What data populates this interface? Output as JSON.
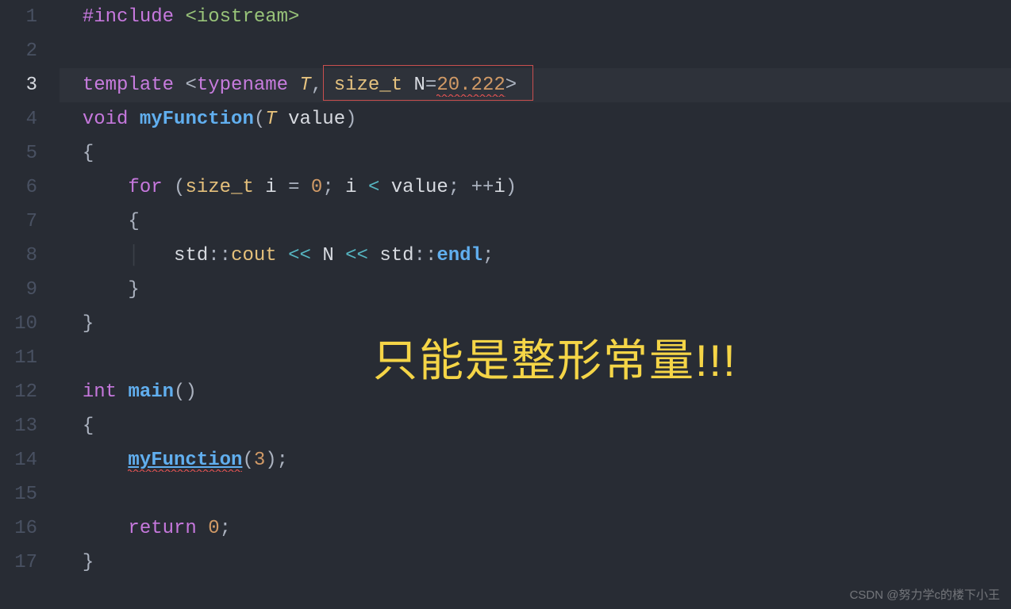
{
  "lines": {
    "count": 17,
    "active": 3
  },
  "code": {
    "l1_include": "#include",
    "l1_header": "<iostream>",
    "l3_template": "template",
    "l3_open": "<",
    "l3_typename": "typename",
    "l3_T": "T",
    "l3_comma": ",",
    "l3_size_t": "size_t",
    "l3_N": "N",
    "l3_eq": "=",
    "l3_val": "20.222",
    "l3_close": ">",
    "l4_void": "void",
    "l4_fn": "myFunction",
    "l4_lp": "(",
    "l4_Ttype": "T",
    "l4_param": "value",
    "l4_rp": ")",
    "l5_brace": "{",
    "l6_for": "for",
    "l6_lp": "(",
    "l6_size_t": "size_t",
    "l6_i": "i",
    "l6_eq": "=",
    "l6_zero": "0",
    "l6_semi1": ";",
    "l6_i2": "i",
    "l6_lt": "<",
    "l6_value": "value",
    "l6_semi2": ";",
    "l6_inc": "++",
    "l6_i3": "i",
    "l6_rp": ")",
    "l7_brace": "{",
    "l8_std1": "std",
    "l8_dc1": "::",
    "l8_cout": "cout",
    "l8_ls1": "<<",
    "l8_N": "N",
    "l8_ls2": "<<",
    "l8_std2": "std",
    "l8_dc2": "::",
    "l8_endl": "endl",
    "l8_semi": ";",
    "l9_brace": "}",
    "l10_brace": "}",
    "l12_int": "int",
    "l12_main": "main",
    "l12_par": "()",
    "l13_brace": "{",
    "l14_fn": "myFunction",
    "l14_lp": "(",
    "l14_arg": "3",
    "l14_rp": ")",
    "l14_semi": ";",
    "l16_return": "return",
    "l16_zero": "0",
    "l16_semi": ";",
    "l17_brace": "}"
  },
  "annotation": "只能是整形常量!!!",
  "watermark": "CSDN @努力学c的楼下小王"
}
